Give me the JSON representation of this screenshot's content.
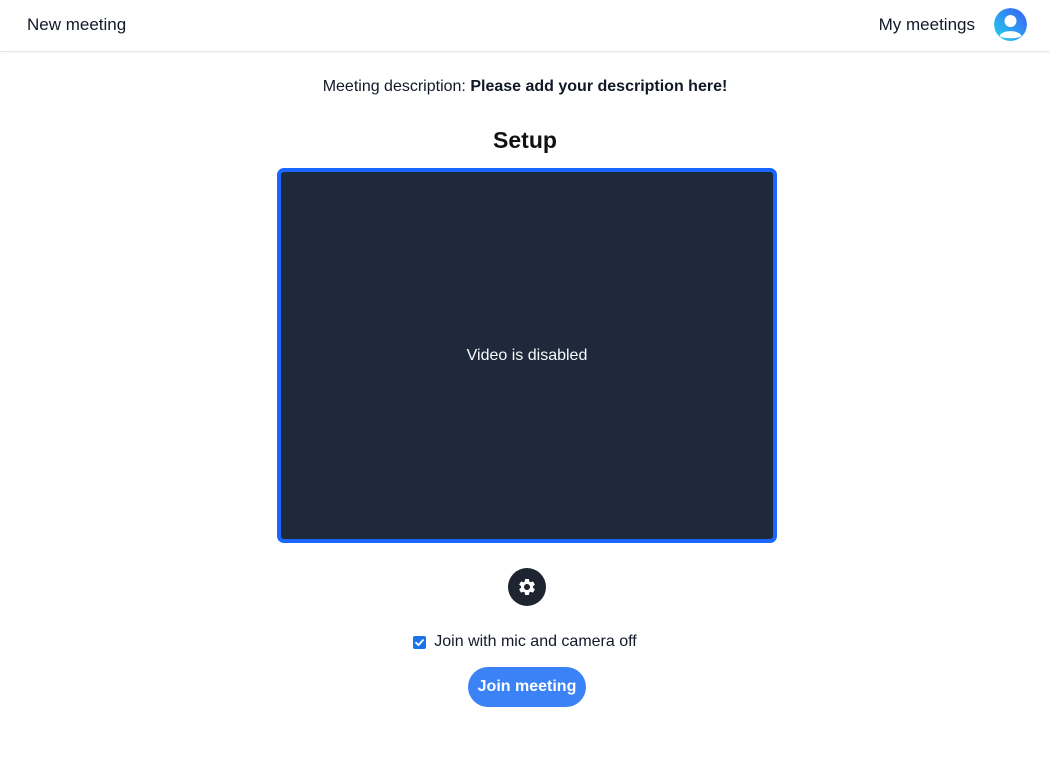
{
  "header": {
    "new_meeting_label": "New meeting",
    "my_meetings_label": "My meetings",
    "avatar_icon": "user-avatar-icon"
  },
  "description": {
    "prefix": "Meeting description: ",
    "text": "Please add your description here!"
  },
  "setup": {
    "title": "Setup",
    "video_status": "Video is disabled",
    "settings_icon": "gear-icon"
  },
  "join": {
    "checkbox_label": "Join with mic and camera off",
    "checkbox_checked": true,
    "button_label": "Join meeting"
  },
  "colors": {
    "accent": "#1a66ff",
    "join_button": "#3b82f6",
    "video_background": "#1e293b"
  }
}
